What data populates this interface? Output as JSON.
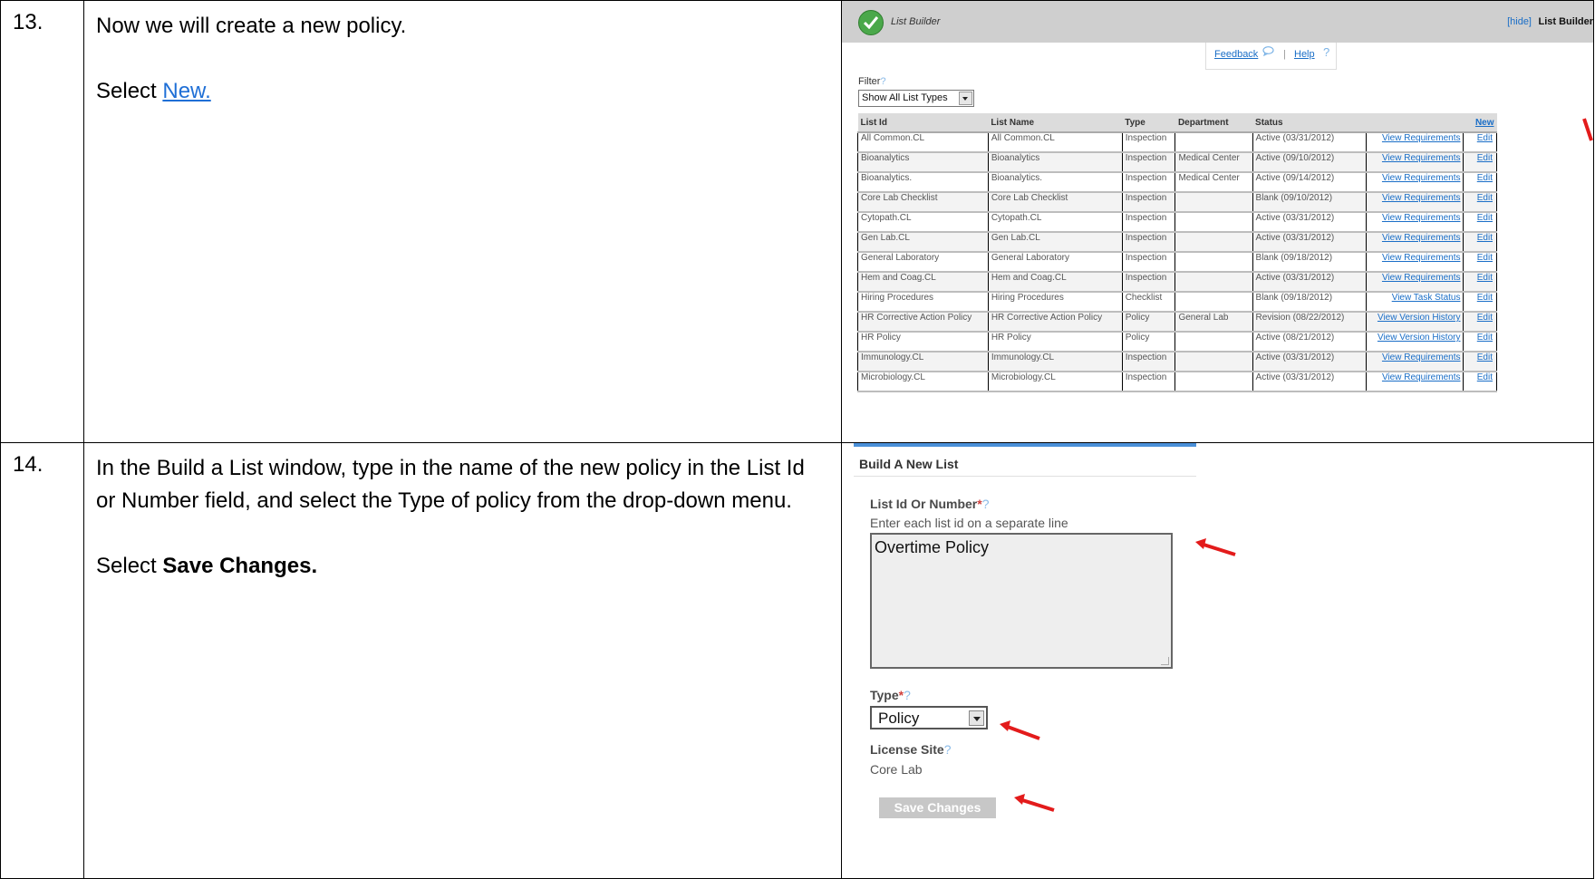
{
  "steps": [
    {
      "number": "13.",
      "instruction_1": "Now we will create a new policy.",
      "instruction_2_prefix": "Select ",
      "instruction_2_link": "New."
    },
    {
      "number": "14.",
      "instruction_1": "In the Build a List window, type in the name of the new policy in the List Id or Number field, and select the Type of policy from the drop-down menu.",
      "instruction_2_prefix": "Select ",
      "instruction_2_bold": "Save Changes."
    }
  ],
  "list_builder": {
    "header_title": "List Builder",
    "hide_link": "[hide]",
    "header_right": "List Builder",
    "feedback_link": "Feedback",
    "help_link": "Help",
    "help_icon": "?",
    "filter_label": "Filter",
    "filter_help": "?",
    "filter_value": "Show All List Types",
    "columns": [
      "List Id",
      "List Name",
      "Type",
      "Department",
      "Status",
      "",
      "New"
    ],
    "rows": [
      {
        "id": "All Common.CL",
        "name": "All Common.CL",
        "type": "Inspection",
        "dept": "",
        "status": "Active (03/31/2012)",
        "action": "View Requirements",
        "edit": "Edit"
      },
      {
        "id": "Bioanalytics",
        "name": "Bioanalytics",
        "type": "Inspection",
        "dept": "Medical Center",
        "status": "Active (09/10/2012)",
        "action": "View Requirements",
        "edit": "Edit"
      },
      {
        "id": "Bioanalytics.",
        "name": "Bioanalytics.",
        "type": "Inspection",
        "dept": "Medical Center",
        "status": "Active (09/14/2012)",
        "action": "View Requirements",
        "edit": "Edit"
      },
      {
        "id": "Core Lab Checklist",
        "name": "Core Lab Checklist",
        "type": "Inspection",
        "dept": "",
        "status": "Blank (09/10/2012)",
        "action": "View Requirements",
        "edit": "Edit"
      },
      {
        "id": "Cytopath.CL",
        "name": "Cytopath.CL",
        "type": "Inspection",
        "dept": "",
        "status": "Active (03/31/2012)",
        "action": "View Requirements",
        "edit": "Edit"
      },
      {
        "id": "Gen Lab.CL",
        "name": "Gen Lab.CL",
        "type": "Inspection",
        "dept": "",
        "status": "Active (03/31/2012)",
        "action": "View Requirements",
        "edit": "Edit"
      },
      {
        "id": "General Laboratory",
        "name": "General Laboratory",
        "type": "Inspection",
        "dept": "",
        "status": "Blank (09/18/2012)",
        "action": "View Requirements",
        "edit": "Edit"
      },
      {
        "id": "Hem and Coag.CL",
        "name": "Hem and Coag.CL",
        "type": "Inspection",
        "dept": "",
        "status": "Active (03/31/2012)",
        "action": "View Requirements",
        "edit": "Edit"
      },
      {
        "id": "Hiring Procedures",
        "name": "Hiring Procedures",
        "type": "Checklist",
        "dept": "",
        "status": "Blank (09/18/2012)",
        "action": "View Task Status",
        "edit": "Edit"
      },
      {
        "id": "HR Corrective Action Policy",
        "name": "HR Corrective Action Policy",
        "type": "Policy",
        "dept": "General Lab",
        "status": "Revision (08/22/2012)",
        "action": "View Version History",
        "edit": "Edit"
      },
      {
        "id": "HR Policy",
        "name": "HR Policy",
        "type": "Policy",
        "dept": "",
        "status": "Active (08/21/2012)",
        "action": "View Version History",
        "edit": "Edit"
      },
      {
        "id": "Immunology.CL",
        "name": "Immunology.CL",
        "type": "Inspection",
        "dept": "",
        "status": "Active (03/31/2012)",
        "action": "View Requirements",
        "edit": "Edit"
      },
      {
        "id": "Microbiology.CL",
        "name": "Microbiology.CL",
        "type": "Inspection",
        "dept": "",
        "status": "Active (03/31/2012)",
        "action": "View Requirements",
        "edit": "Edit"
      }
    ]
  },
  "build_list": {
    "title": "Build A New List",
    "list_id_label": "List Id Or Number",
    "required_mark": "*",
    "help_mark": "?",
    "list_id_hint": "Enter each list id on a separate line",
    "list_id_value": "Overtime Policy",
    "type_label": "Type",
    "type_value": "Policy",
    "license_site_label": "License Site",
    "license_site_value": "Core Lab",
    "save_button": "Save Changes"
  },
  "colors": {
    "link": "#1a6ec7",
    "doc_link": "#1f6fd6",
    "annotation_arrow": "#e31b1b",
    "check_green": "#4aa84a"
  }
}
